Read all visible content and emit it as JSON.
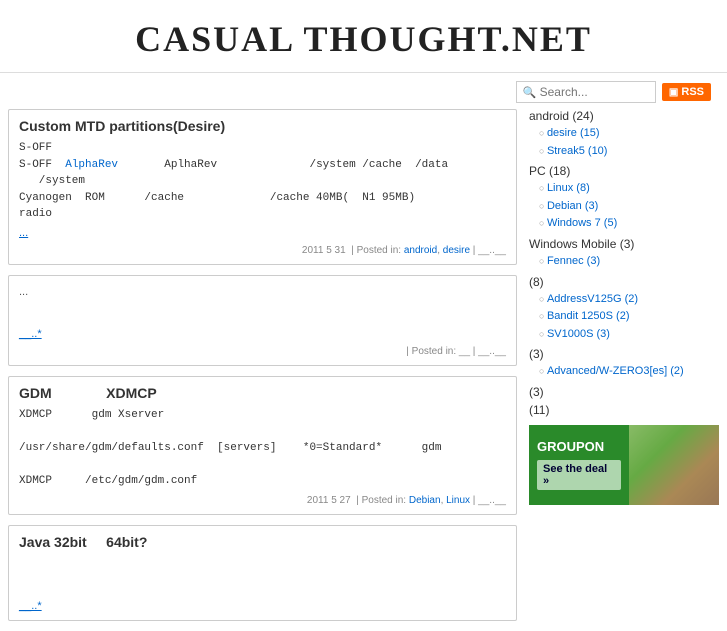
{
  "site": {
    "title": "CASUAL THOUGHT.NET"
  },
  "search": {
    "placeholder": "Search...",
    "rss_label": "RSS"
  },
  "posts": [
    {
      "id": "post1",
      "title": "Custom MTD partitions(Desire)",
      "body_lines": [
        "S-OFF",
        "S-OFF  AlphaRev      AplhaRev            /system /cache  /data    /system",
        "Cyanogen  ROM        /cache              /cache 40MB(  N1 95MB)",
        "radio"
      ],
      "read_more": "...",
      "meta": "2011 5 31  | Posted in: android, desire | __..__"
    },
    {
      "id": "post2",
      "title": "",
      "body_lines": [
        "..."
      ],
      "read_more": "__..*",
      "meta": "| Posted in: __ | __..__"
    },
    {
      "id": "post3",
      "title": "GDM                XDMCP",
      "body_lines": [
        "XDMCP      gdm Xserver",
        "",
        "/usr/share/gdm/defaults.conf  [servers]    *0=Standard*      gdm",
        "",
        "XDMCP     /etc/gdm/gdm.conf"
      ],
      "read_more": "",
      "meta": "2011 5 27  | Posted in: Debian, Linux | __..__"
    },
    {
      "id": "post4",
      "title": "Java 32bit     64bit?",
      "body_lines": [],
      "read_more": "__..*",
      "meta": ""
    }
  ],
  "sidebar": {
    "categories": [
      {
        "name": "android (24)",
        "link": "#",
        "children": [
          {
            "name": "desire (15)",
            "link": "#"
          },
          {
            "name": "Streak5 (10)",
            "link": "#"
          }
        ]
      },
      {
        "name": "PC (18)",
        "link": "#",
        "children": [
          {
            "name": "Linux (8)",
            "link": "#"
          },
          {
            "name": "Debian (3)",
            "link": "#"
          },
          {
            "name": "Windows 7 (5)",
            "link": "#"
          }
        ]
      },
      {
        "name": "Windows Mobile (3)",
        "link": "#",
        "children": [
          {
            "name": "Fennec (3)",
            "link": "#"
          }
        ]
      },
      {
        "name": "(8)",
        "link": "#",
        "children": [
          {
            "name": "AddressV125G (2)",
            "link": "#"
          },
          {
            "name": "Bandit 1250S (2)",
            "link": "#"
          },
          {
            "name": "SV1000S (3)",
            "link": "#"
          }
        ]
      },
      {
        "name": "(3)",
        "link": "#",
        "children": [
          {
            "name": "Advanced/W-ZERO3[es] (2)",
            "link": "#"
          }
        ]
      },
      {
        "name": "(3)",
        "link": "#",
        "children": []
      },
      {
        "name": "(11)",
        "link": "#",
        "children": []
      }
    ],
    "ad": {
      "brand": "GROUPON",
      "cta": "See the deal »"
    }
  }
}
